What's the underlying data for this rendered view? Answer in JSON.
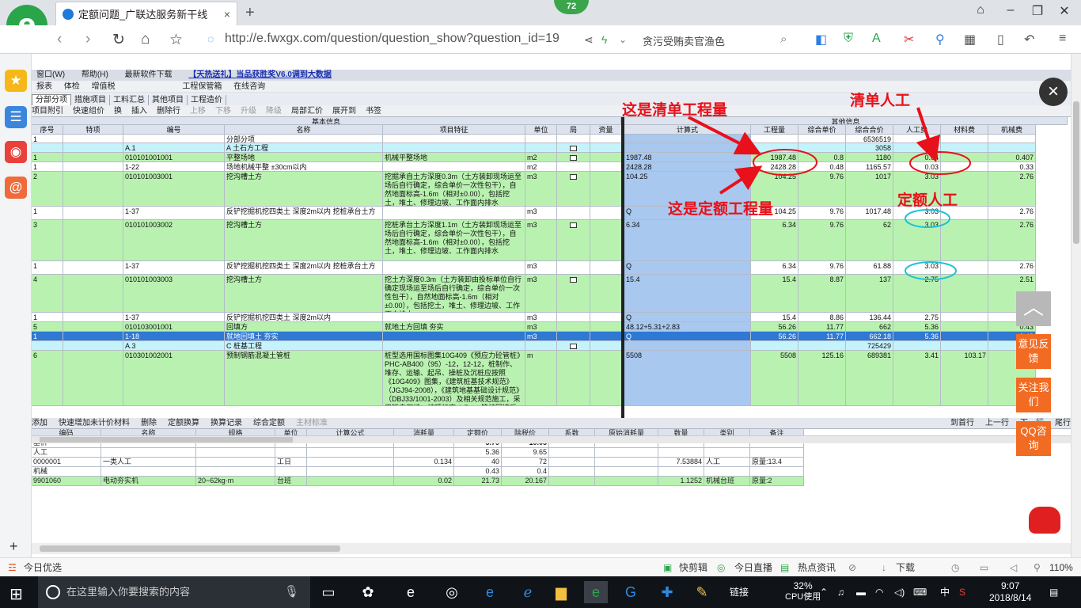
{
  "browser": {
    "tab_title": "定额问题_广联达服务新干线",
    "tab_close": "×",
    "new_tab": "+",
    "badge_count": "72",
    "url": "http://e.fwxgx.com/question/question_show?question_id=19",
    "search_text": "贪污受贿卖官渔色",
    "sidebar_icons": [
      "star-icon",
      "list-icon",
      "weibo-icon",
      "email-icon"
    ],
    "sidebar_plus": "+"
  },
  "app": {
    "menubar": [
      "窗口(W)",
      "帮助(H)",
      "最新软件下载"
    ],
    "menubar_link": "【天热送礼】当品获胜奖V6.0调到大数据",
    "toolbar1": [
      "报表",
      "体检",
      "增值税",
      "工程保管箱",
      "在线咨询"
    ],
    "tabs": [
      "分部分项",
      "措施项目",
      "工料汇总",
      "其他项目",
      "工程造价"
    ],
    "tabs_active": 0,
    "toolbar2": [
      "项目附引",
      "快速组价",
      "换",
      "插入",
      "删除行",
      "上移",
      "下移",
      "升级",
      "降级",
      "局部汇价",
      "展开到",
      "书签"
    ],
    "toolbar2_disabled": [
      5,
      6,
      7,
      8
    ],
    "group_headers": {
      "basic": "基本信息",
      "other": "其他信息"
    },
    "columns": [
      "序号",
      "特项",
      "编号",
      "名称",
      "项目特征",
      "单位",
      "局",
      "资量",
      "计算式",
      "工程量",
      "综合单价",
      "综合合价",
      "人工费",
      "材料费",
      "机械费"
    ],
    "rows": [
      {
        "style": "w",
        "seq": "1",
        "code": "",
        "name": "分部分项",
        "feature": "",
        "unit": "",
        "chk": false,
        "calc": "",
        "qty": "",
        "price": "",
        "total": "6536519",
        "labor": "",
        "mat": "",
        "mach": ""
      },
      {
        "style": "c",
        "seq": "",
        "code": "A.1",
        "name": "A 土石方工程",
        "feature": "",
        "unit": "",
        "chk": true,
        "calc": "",
        "qty": "",
        "price": "",
        "total": "3058",
        "labor": "",
        "mat": "",
        "mach": ""
      },
      {
        "style": "g",
        "seq": "1",
        "code": "010101001001",
        "name": "平整场地",
        "feature": "机械平整场地",
        "unit": "m2",
        "chk": true,
        "calc": "1987.48",
        "qty": "1987.48",
        "price": "0.8",
        "total": "1180",
        "labor": "0.04",
        "mat": "",
        "mach": "0.407"
      },
      {
        "style": "w",
        "seq": "1",
        "code": "1-22",
        "name": "场地机械平整 ±30cm以内",
        "feature": "",
        "unit": "m2",
        "chk": false,
        "calc": "2428.28",
        "qty": "2428.28",
        "price": "0.48",
        "total": "1165.57",
        "labor": "0.03",
        "mat": "",
        "mach": "0.33"
      },
      {
        "style": "g",
        "seq": "2",
        "code": "010101003001",
        "name": "挖沟槽土方",
        "feature": "挖掘承自土方深度0.3m（土方装卸现场运至场后自行确定，综合单价一次性包干），自然地面标高-1.6m（相对±0.00），包括挖土，堆土、修理边坡、工作面内排水",
        "unit": "m3",
        "chk": true,
        "calc": "104.25",
        "qty": "104.25",
        "price": "9.76",
        "total": "1017",
        "labor": "3.03",
        "mat": "",
        "mach": "2.76"
      },
      {
        "style": "w",
        "seq": "1",
        "code": "1-37",
        "name": "反铲挖掘机挖四类土 深度2m以内 挖桩承台土方",
        "feature": "",
        "unit": "m3",
        "chk": false,
        "calc": "Q",
        "qty": "104.25",
        "price": "9.76",
        "total": "1017.48",
        "labor": "3.03",
        "mat": "",
        "mach": "2.76"
      },
      {
        "style": "g",
        "seq": "3",
        "code": "010101003002",
        "name": "挖沟槽土方",
        "feature": "挖桩承台土方深度1.1m（土方装卸现场运至场后自行确定，综合单价一次性包干），自然地面标高-1.6m（相对±0.00），包括挖土，堆土、修理边坡、工作面内排水",
        "unit": "m3",
        "chk": true,
        "calc": "6.34",
        "qty": "6.34",
        "price": "9.76",
        "total": "62",
        "labor": "3.03",
        "mat": "",
        "mach": "2.76"
      },
      {
        "style": "w",
        "seq": "1",
        "code": "1-37",
        "name": "反铲挖掘机挖四类土 深度2m以内 挖桩承台土方",
        "feature": "",
        "unit": "m3",
        "chk": false,
        "calc": "Q",
        "qty": "6.34",
        "price": "9.76",
        "total": "61.88",
        "labor": "3.03",
        "mat": "",
        "mach": "2.76"
      },
      {
        "style": "g",
        "seq": "4",
        "code": "010101003003",
        "name": "挖沟槽土方",
        "feature": "挖土方深度0.3m（土方装卸由投标单位自行确定现场运至场后自行确定，综合单价一次性包干），自然地面标高-1.6m（相对±0.00），包括挖土，堆土、修理边坡、工作面内排水",
        "unit": "m3",
        "chk": true,
        "calc": "15.4",
        "qty": "15.4",
        "price": "8.87",
        "total": "137",
        "labor": "2.75",
        "mat": "",
        "mach": "2.51"
      },
      {
        "style": "w",
        "seq": "1",
        "code": "1-37",
        "name": "反铲挖掘机挖四类土 深度2m以内",
        "feature": "",
        "unit": "m3",
        "chk": false,
        "calc": "Q",
        "qty": "15.4",
        "price": "8.86",
        "total": "136.44",
        "labor": "2.75",
        "mat": "",
        "mach": "2.5"
      },
      {
        "style": "g",
        "seq": "5",
        "code": "010103001001",
        "name": "回填方",
        "feature": "就地土方回填 夯实",
        "unit": "m3",
        "chk": false,
        "calc": "48.12+5.31+2.83",
        "qty": "56.26",
        "price": "11.77",
        "total": "662",
        "labor": "5.36",
        "mat": "",
        "mach": "0.43"
      },
      {
        "style": "b",
        "seq": "1",
        "code": "1-18",
        "name": "就地回填土 夯实",
        "feature": "",
        "unit": "m3",
        "chk": false,
        "calc": "Q",
        "qty": "56.26",
        "price": "11.77",
        "total": "662.18",
        "labor": "5.36",
        "mat": "",
        "mach": "0.43"
      },
      {
        "style": "c",
        "seq": "",
        "code": "A.3",
        "name": "C 桩基工程",
        "feature": "",
        "unit": "",
        "chk": true,
        "calc": "",
        "qty": "",
        "price": "",
        "total": "725429",
        "labor": "",
        "mat": "",
        "mach": ""
      },
      {
        "style": "g",
        "seq": "6",
        "code": "010301002001",
        "name": "预制钢筋混凝土管桩",
        "feature": "桩型选用国标图集10G409《预应力砼管桩》PHC-AB400（95）-12，12-12，桩制作、堆存、运输、起吊、操桩及沉桩应按照《10G409》图集，《建筑桩基技术规范》（JGJ94-2008），《建筑地基基础设计规范》（DBJ33/1001-2003）及相关规范施工，采用锤击沉桩，桩顶标高-1.7m，管桩回填后场地标高",
        "unit": "m",
        "chk": false,
        "calc": "5508",
        "qty": "5508",
        "price": "125.16",
        "total": "689381",
        "labor": "3.41",
        "mat": "103.17",
        "mach": "10"
      }
    ],
    "bottom_toolbar": [
      "添加",
      "快速增加未计价材料",
      "删除",
      "定额换算",
      "换算记录",
      "综合定额",
      "主材标准"
    ],
    "bottom_nav": [
      "到首行",
      "上一行",
      "下一行",
      "尾行"
    ],
    "bottom_columns": [
      "编码",
      "名称",
      "规格",
      "单位",
      "计算公式",
      "消耗量",
      "定额价",
      "除税价",
      "系数",
      "原始消耗量",
      "数量",
      "类别",
      "备注"
    ],
    "bottom_rows": [
      {
        "code": "基价",
        "name": "",
        "spec": "",
        "unit": "",
        "formula": "",
        "cons": "",
        "price": "5.79",
        "tax": "10.05",
        "coef": "",
        "orig": "",
        "qty": "",
        "type": "",
        "note": "",
        "sel": false
      },
      {
        "code": "人工",
        "name": "",
        "spec": "",
        "unit": "",
        "formula": "",
        "cons": "",
        "price": "5.36",
        "tax": "9.65",
        "coef": "",
        "orig": "",
        "qty": "",
        "type": "",
        "note": "",
        "sel": false
      },
      {
        "code": "0000001",
        "name": "一类人工",
        "spec": "",
        "unit": "工日",
        "formula": "",
        "cons": "0.134",
        "price": "40",
        "tax": "72",
        "coef": "",
        "orig": "",
        "qty": "7.53884",
        "type": "人工",
        "note": "原量:13.4",
        "sel": false
      },
      {
        "code": "机械",
        "name": "",
        "spec": "",
        "unit": "",
        "formula": "",
        "cons": "",
        "price": "0.43",
        "tax": "0.4",
        "coef": "",
        "orig": "",
        "qty": "",
        "type": "",
        "note": "",
        "sel": false
      },
      {
        "code": "9901060",
        "name": "电动夯实机",
        "spec": "20~62kg·m",
        "unit": "台班",
        "formula": "",
        "cons": "0.02",
        "price": "21.73",
        "tax": "20.167",
        "coef": "",
        "orig": "",
        "qty": "1.1252",
        "type": "机械台班",
        "note": "原量:2",
        "sel": true
      }
    ]
  },
  "annotations": {
    "list_quantity": "这是清单工程量",
    "quota_quantity": "这是定额工程量",
    "list_labor": "清单人工",
    "quota_labor": "定额人工",
    "color": "#e8101a",
    "circle_red": "#e8101a",
    "circle_cyan": "#1fc0d8"
  },
  "floating": {
    "close": "×",
    "to_top": "︿",
    "feedback": "意见反馈",
    "follow": "关注我们",
    "qq": "QQ咨询"
  },
  "statusbar": {
    "left": "今日优选",
    "items": [
      "快剪辑",
      "今日直播",
      "热点资讯",
      "下载"
    ],
    "zoom": "110%"
  },
  "taskbar": {
    "search_placeholder": "在这里输入你要搜索的内容",
    "link": "链接",
    "cpu_percent": "32%",
    "cpu_label": "CPU使用",
    "ime": "中",
    "time": "9:07",
    "date": "2018/8/14"
  }
}
